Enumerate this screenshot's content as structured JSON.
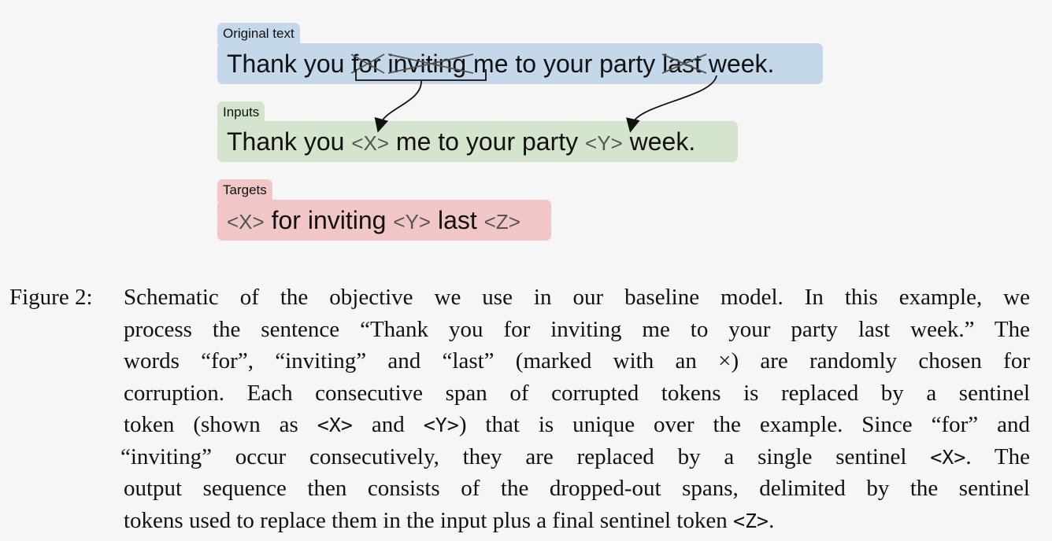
{
  "figure": {
    "original": {
      "label": "Original text",
      "w1": "Thank you",
      "w2": "for",
      "w3": "inviting",
      "w4": "me to your party",
      "w5": "last",
      "w6": "week."
    },
    "inputs": {
      "label": "Inputs",
      "w1": "Thank you",
      "s1": "<X>",
      "w2": "me to your party",
      "s2": "<Y>",
      "w3": "week."
    },
    "targets": {
      "label": "Targets",
      "s1": "<X>",
      "w1": "for inviting",
      "s2": "<Y>",
      "w2": "last",
      "s3": "<Z>"
    }
  },
  "caption": {
    "label": "Figure 2:",
    "l1": "Schematic of the objective we use in our baseline model.  In this example, we",
    "l2": "process the sentence “Thank you for inviting me to your party last week.” The",
    "l3": "words “for”, “inviting” and “last” (marked with an ×) are randomly chosen for",
    "l4": "corruption. Each consecutive span of corrupted tokens is replaced by a sentinel",
    "l5a": "token (shown as ",
    "l5b": "<X>",
    "l5c": " and ",
    "l5d": "<Y>",
    "l5e": ") that is unique over the example. Since “for” and",
    "l6a": "“inviting” occur consecutively, they are replaced by a single sentinel ",
    "l6b": "<X>",
    "l6c": ". The",
    "l7": "output sequence then consists of the dropped-out spans, delimited by the sentinel",
    "l8a": "tokens used to replace them in the input plus a final sentinel token ",
    "l8b": "<Z>",
    "l8c": "."
  }
}
